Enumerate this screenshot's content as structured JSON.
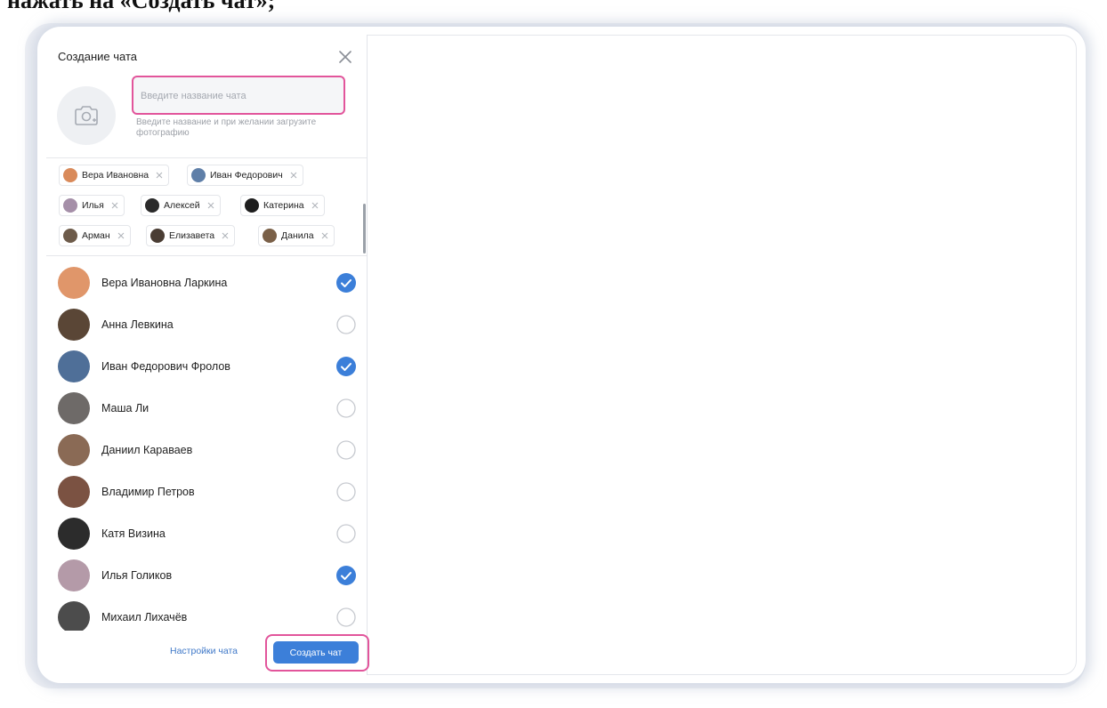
{
  "caption": "нажать на «Создать чат»;",
  "panel": {
    "title": "Создание чата",
    "close_icon": "close-icon",
    "photo_icon": "camera-plus-icon",
    "name_input": {
      "placeholder": "Введите название чата",
      "value": ""
    },
    "hint": "Введите название и при желании загрузите фотографию"
  },
  "chips": [
    {
      "label": "Вера Ивановна",
      "color": "#d98a5a"
    },
    {
      "label": "Иван Федорович",
      "color": "#5f7fa8"
    },
    {
      "label": "Илья",
      "color": "#a58fa8"
    },
    {
      "label": "Алексей",
      "color": "#2a2a2a"
    },
    {
      "label": "Катерина",
      "color": "#1e1e1e"
    },
    {
      "label": "Арман",
      "color": "#6d5b4a"
    },
    {
      "label": "Елизавета",
      "color": "#4a3d34"
    },
    {
      "label": "Данила",
      "color": "#7a6048"
    }
  ],
  "contacts": [
    {
      "name": "Вера Ивановна Ларкина",
      "selected": true,
      "color": "#e0966a"
    },
    {
      "name": "Анна Левкина",
      "selected": false,
      "color": "#5a4636"
    },
    {
      "name": "Иван Федорович Фролов",
      "selected": true,
      "color": "#4f6f98"
    },
    {
      "name": "Маша Ли",
      "selected": false,
      "color": "#6e6a68"
    },
    {
      "name": "Даниил Караваев",
      "selected": false,
      "color": "#8a6a55"
    },
    {
      "name": "Владимир Петров",
      "selected": false,
      "color": "#7b5242"
    },
    {
      "name": "Катя Визина",
      "selected": false,
      "color": "#2c2c2c"
    },
    {
      "name": "Илья Голиков",
      "selected": true,
      "color": "#b49aa8"
    },
    {
      "name": "Михаил Лихачёв",
      "selected": false,
      "color": "#4c4c4c"
    }
  ],
  "footer": {
    "settings_label": "Настройки чата",
    "create_label": "Создать чат"
  },
  "colors": {
    "accent": "#3c7fd9",
    "highlight": "#e2559b",
    "check": "#3c7fd9"
  }
}
